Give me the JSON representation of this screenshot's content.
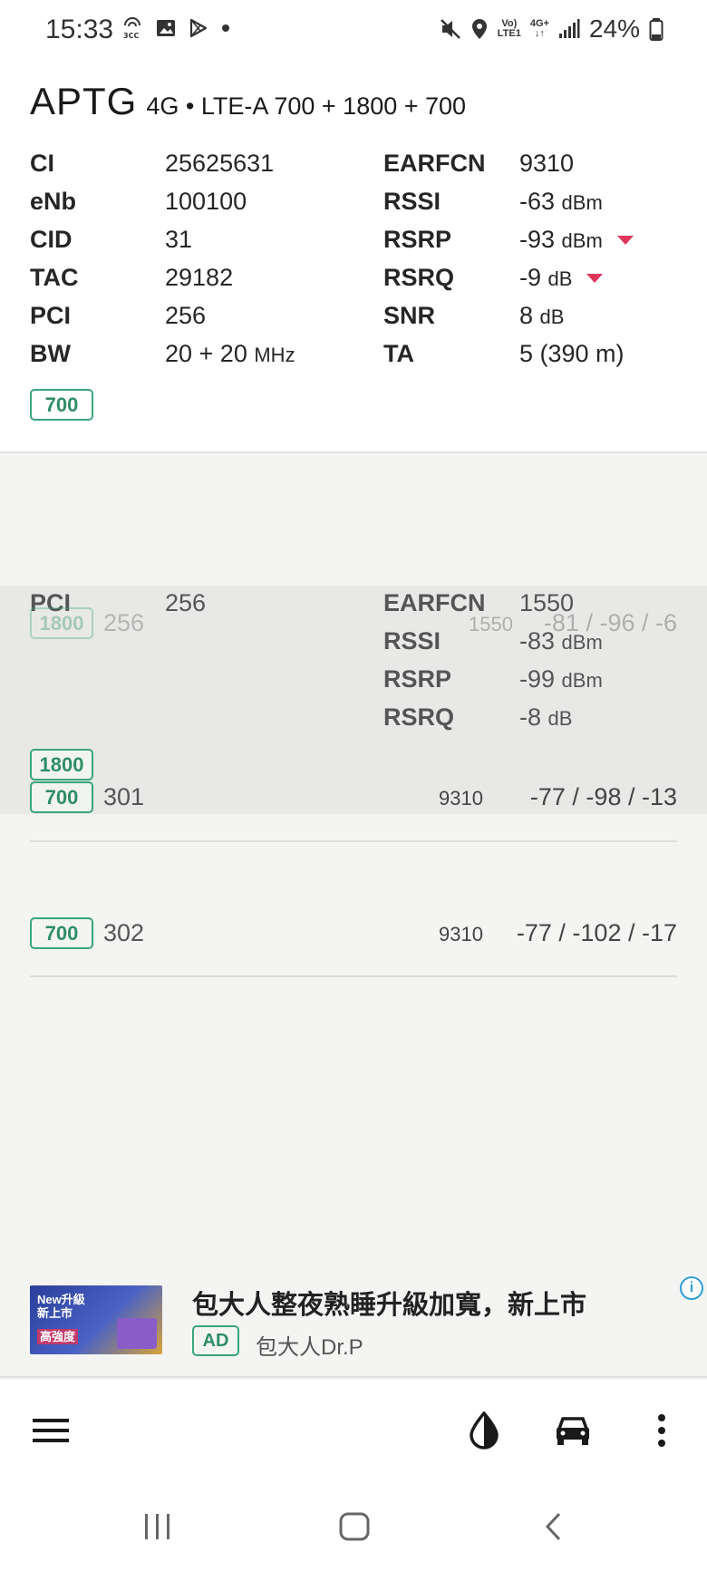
{
  "status": {
    "time": "15:33",
    "battery_percent": "24%",
    "volte_label_top": "Vo)",
    "volte_label_bottom": "LTE1",
    "net_label": "4G+"
  },
  "operator": {
    "name": "APTG",
    "tech": "4G • LTE-A 700 + 1800 + 700"
  },
  "cell_info": {
    "left": [
      {
        "label": "CI",
        "value": "25625631"
      },
      {
        "label": "eNb",
        "value": "100100"
      },
      {
        "label": "CID",
        "value": "31"
      },
      {
        "label": "TAC",
        "value": "29182"
      },
      {
        "label": "PCI",
        "value": "256"
      },
      {
        "label": "BW",
        "value": "20 + 20",
        "unit": "MHz"
      }
    ],
    "right": [
      {
        "label": "EARFCN",
        "value": "9310"
      },
      {
        "label": "RSSI",
        "value": "-63",
        "unit": "dBm"
      },
      {
        "label": "RSRP",
        "value": "-93",
        "unit": "dBm",
        "trend": "down"
      },
      {
        "label": "RSRQ",
        "value": "-9",
        "unit": "dB",
        "trend": "down"
      },
      {
        "label": "SNR",
        "value": "8",
        "unit": "dB"
      },
      {
        "label": "TA",
        "value": "5 (390 m)"
      }
    ],
    "band": "700"
  },
  "secondary_detail": {
    "pci_label": "PCI",
    "pci_value": "256",
    "earfcn_label": "EARFCN",
    "earfcn_value": "1550",
    "rssi_label": "RSSI",
    "rssi_value": "-83",
    "rssi_unit": "dBm",
    "rsrp_label": "RSRP",
    "rsrp_value": "-99",
    "rsrp_unit": "dBm",
    "rsrq_label": "RSRQ",
    "rsrq_value": "-8",
    "rsrq_unit": "dB",
    "band": "1800"
  },
  "neighbors": [
    {
      "band": "1800",
      "pci": "256",
      "earfcn": "1550",
      "signal": "-81 / -96 / -6"
    },
    {
      "band": "700",
      "pci": "301",
      "earfcn": "9310",
      "signal": "-77 / -98 / -13"
    },
    {
      "band": "700",
      "pci": "302",
      "earfcn": "9310",
      "signal": "-77 / -102 / -17"
    }
  ],
  "ad": {
    "title": "包大人整夜熟睡升級加寬，新上市",
    "badge": "AD",
    "sponsor": "包大人Dr.P",
    "info": "i",
    "image_text_1": "New升級",
    "image_text_2": "新上市",
    "image_text_3": "高強度"
  },
  "toolbar": {
    "icons": [
      "menu-icon",
      "contrast-icon",
      "car-icon",
      "more-vert-icon"
    ]
  },
  "colors": {
    "accent_green": "#3aa57a",
    "trend_down": "#e0365b",
    "info_blue": "#2f9fd6"
  }
}
